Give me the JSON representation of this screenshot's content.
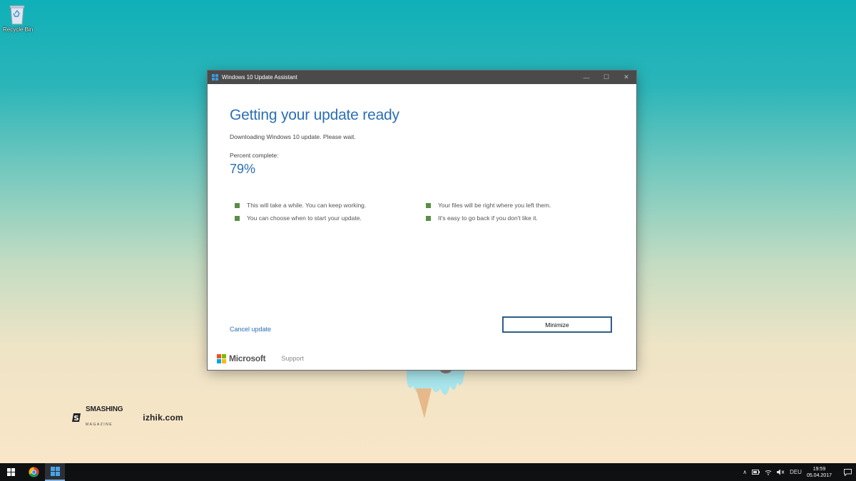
{
  "desktop": {
    "recycle_bin_label": "Recycle Bin"
  },
  "watermark": {
    "smashing": "SMASHING",
    "magazine": "MAGAZINE",
    "site": "izhik.com"
  },
  "window": {
    "title": "Windows 10 Update Assistant",
    "controls": {
      "minimize": "—",
      "maximize": "☐",
      "close": "✕"
    },
    "heading": "Getting your update ready",
    "subtext": "Downloading Windows 10 update. Please wait.",
    "percent_label": "Percent complete:",
    "percent_value": "79%",
    "bullets": [
      "This will take a while. You can keep working.",
      "Your files will be right where you left them.",
      "You can choose when to start your update.",
      "It's easy to go back if you don't like it."
    ],
    "cancel_link": "Cancel update",
    "minimize_button": "Minimize",
    "footer": {
      "brand": "Microsoft",
      "support": "Support"
    }
  },
  "taskbar": {
    "tray": {
      "chevron": "∧",
      "language": "DEU",
      "time": "19:59",
      "date": "05.04.2017"
    }
  },
  "colors": {
    "accent_blue": "#2b6fb4",
    "bullet_green": "#5a8e46",
    "titlebar": "#4a4a4a",
    "taskbar": "#0e1012"
  }
}
